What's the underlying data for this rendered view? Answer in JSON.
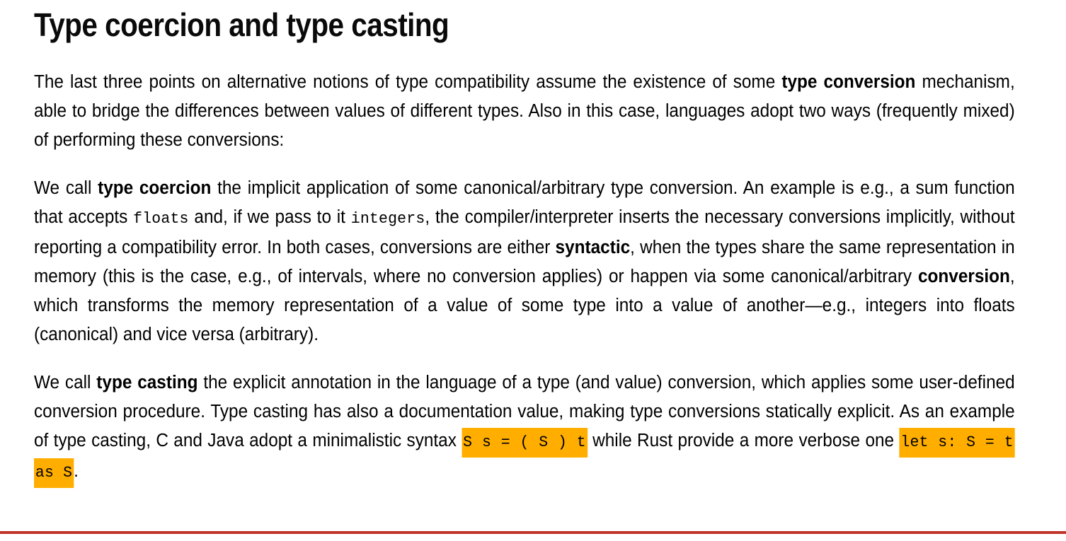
{
  "document": {
    "title": "Type coercion and type casting",
    "accent_highlight_color": "#ffae00",
    "rule_color": "#c0342a",
    "text_color": "#000000",
    "background_color": "#ffffff"
  },
  "paragraphs": {
    "p1": {
      "seg1": "The last three points on alternative notions of type compatibility assume the existence of some ",
      "bold1": "type conversion",
      "seg2": " mechanism, able to bridge the differences between values of different types. Also in this case, languages adopt two ways (frequently mixed) of performing these conversions:"
    },
    "p2": {
      "seg1": "We call ",
      "bold1": "type coercion",
      "seg2": " the implicit application of some canonical/arbitrary type conversion. An example is e.g., a sum function that accepts ",
      "code1": "floats",
      "seg3": " and, if we pass to it ",
      "code2": "integers",
      "seg4": ", the compiler/interpreter inserts the necessary conversions implicitly, without reporting a compatibility error. In both cases, conversions are either ",
      "bold2": "syntactic",
      "seg5": ", when the types share the same representation in memory (this is the case, e.g., of intervals, where no conversion applies) or happen via some canonical/arbitrary ",
      "bold3": "conversion",
      "seg6": ", which transforms the memory representation of a value of some type into a value of another—e.g., integers into floats (canonical) and vice versa (arbitrary)."
    },
    "p3": {
      "seg1": "We call ",
      "bold1": "type casting",
      "seg2": " the explicit annotation in the language of a type (and value) conversion, which applies some user-defined conversion procedure. Type casting has also a documentation value, making type conversions statically explicit. As an example of type casting, C and Java adopt a minimalistic syntax ",
      "highlight1": "S s = ( S ) t",
      "seg3": " while Rust provide a more verbose one ",
      "highlight2": "let s: S = t as S",
      "seg4": "."
    }
  }
}
